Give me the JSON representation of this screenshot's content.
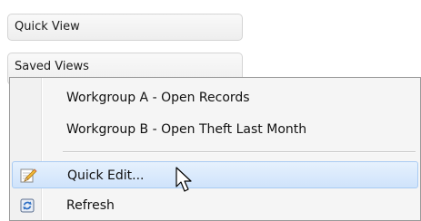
{
  "panel": {
    "quick_view_label": "Quick View",
    "saved_views_label": "Saved Views"
  },
  "context_menu": {
    "items": [
      {
        "label": "Workgroup A - Open Records"
      },
      {
        "label": "Workgroup B - Open Theft Last Month"
      }
    ],
    "actions": [
      {
        "label": "Quick Edit...",
        "icon": "pencil-icon",
        "highlighted": true
      },
      {
        "label": "Refresh",
        "icon": "refresh-icon",
        "highlighted": false
      }
    ]
  },
  "colors": {
    "highlight": "#cfe3fb",
    "highlight_border": "#a9cbf3",
    "menu_background": "#f5f5f5"
  }
}
